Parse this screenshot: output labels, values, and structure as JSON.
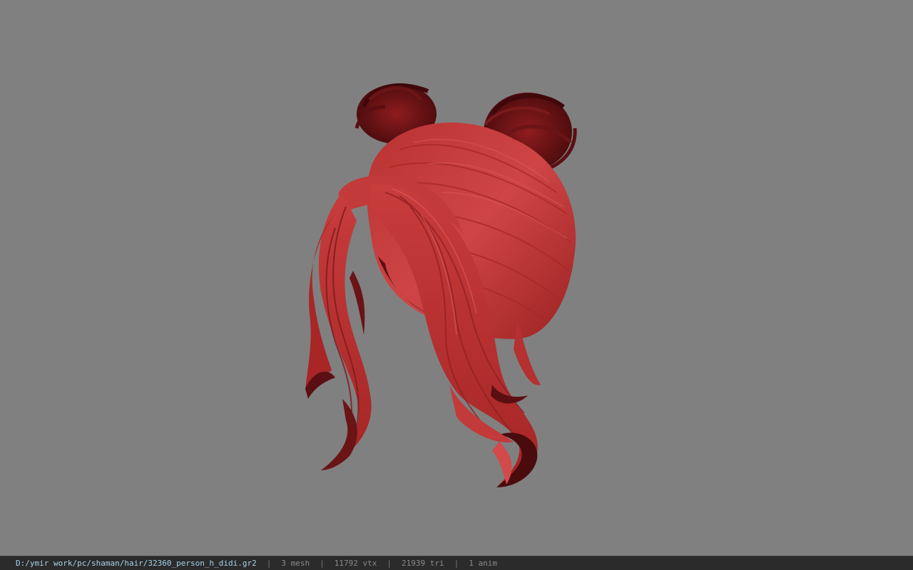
{
  "colors": {
    "background": "#808080",
    "hair_main": "#c23a3a",
    "hair_dark": "#5a0f12",
    "hair_highlight": "#e06060",
    "statusbar_bg": "#2b2b2b",
    "path_text": "#a9d1e6",
    "stat_text": "#8a8a8a"
  },
  "viewport": {
    "model_subject": "red hair mesh with two buns and long curled tails"
  },
  "statusbar": {
    "path": "D:/ymir work/pc/shaman/hair/32360_person_h_didi.gr2",
    "separator": "|",
    "mesh": "3 mesh",
    "vtx": "11792 vtx",
    "tri": "21939 tri",
    "anim": "1 anim"
  }
}
